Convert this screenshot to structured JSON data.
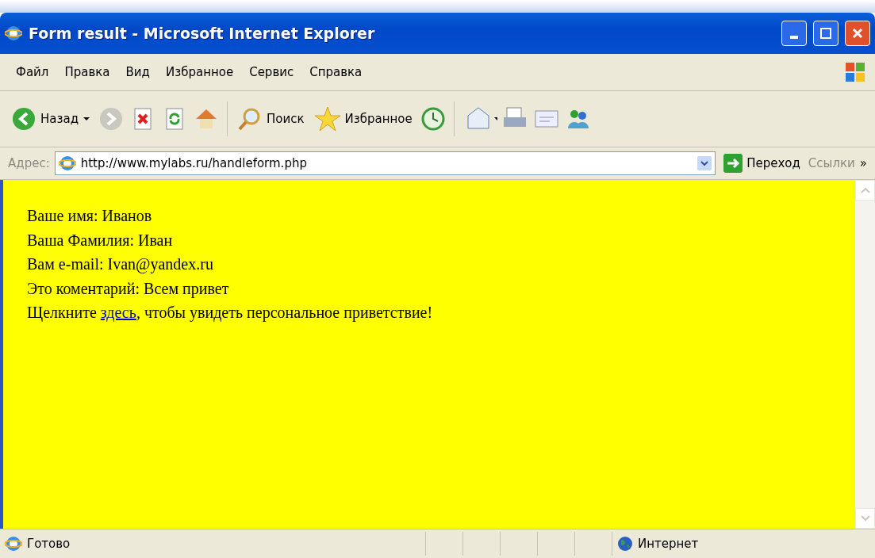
{
  "window": {
    "title": "Form result - Microsoft Internet Explorer"
  },
  "menu": [
    "Файл",
    "Правка",
    "Вид",
    "Избранное",
    "Сервис",
    "Справка"
  ],
  "toolbar": {
    "back": "Назад",
    "search": "Поиск",
    "favorites": "Избранное"
  },
  "address": {
    "label": "Адрес:",
    "value": "http://www.mylabs.ru/handleform.php",
    "go": "Переход",
    "links": "Ссылки",
    "more": "»"
  },
  "content": {
    "lines": [
      {
        "kind": "text",
        "text": "Ваше имя: Иванов"
      },
      {
        "kind": "text",
        "text": "Ваша Фамилия: Иван"
      },
      {
        "kind": "text",
        "text": "Вам e-mail: Ivan@yandex.ru"
      },
      {
        "kind": "text",
        "text": "Это коментарий: Всем привет"
      },
      {
        "kind": "link",
        "before": "Щелкните ",
        "link": "здесь",
        "after": ", чтобы увидеть персональное приветствие!"
      }
    ]
  },
  "status_bar": {
    "text": "Готово",
    "zone": "Интернет"
  }
}
